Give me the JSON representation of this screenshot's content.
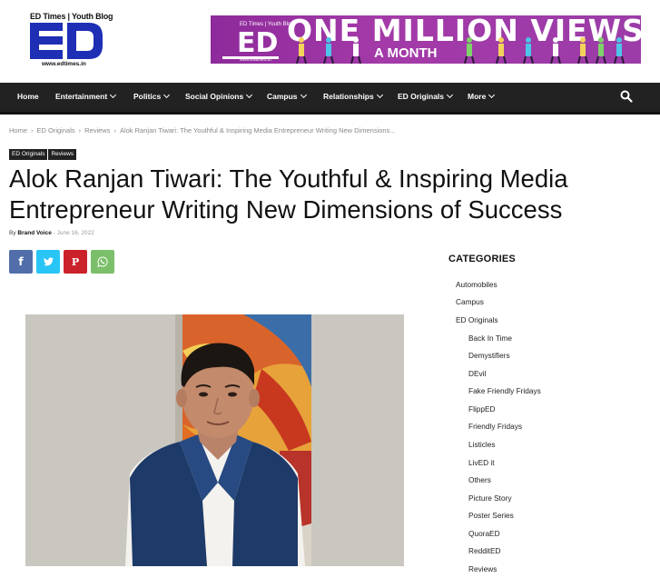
{
  "header": {
    "logo_tagline": "ED Times | Youth Blog",
    "logo_letters": "ED",
    "logo_url": "www.edtimes.in",
    "banner": {
      "tagline": "ED Times | Youth Blog",
      "letters": "ED",
      "url": "www.edtimes.in",
      "title": "ONE MILLION VIEWS",
      "subtitle": "A MONTH"
    }
  },
  "nav": {
    "items": [
      {
        "label": "Home",
        "dropdown": false
      },
      {
        "label": "Entertainment",
        "dropdown": true
      },
      {
        "label": "Politics",
        "dropdown": true
      },
      {
        "label": "Social Opinions",
        "dropdown": true
      },
      {
        "label": "Campus",
        "dropdown": true
      },
      {
        "label": "Relationships",
        "dropdown": true
      },
      {
        "label": "ED Originals",
        "dropdown": true
      },
      {
        "label": "More",
        "dropdown": true
      }
    ],
    "search_icon": "search-icon"
  },
  "breadcrumb": [
    "Home",
    "ED Originals",
    "Reviews",
    "Alok Ranjan Tiwari: The Youthful & Inspiring Media Entrepreneur Writing New Dimensions..."
  ],
  "tags": [
    "ED Originals",
    "Reviews"
  ],
  "article": {
    "title": "Alok Ranjan Tiwari: The Youthful & Inspiring Media Entrepreneur Writing New Dimensions of Success",
    "by": "By",
    "author": "Brand Voice",
    "separator": "-",
    "date": "June 16, 2022"
  },
  "share": {
    "facebook": "f",
    "twitter": "twitter-icon",
    "pinterest": "P",
    "whatsapp": "whatsapp-icon"
  },
  "sidebar": {
    "title": "CATEGORIES",
    "categories": [
      {
        "label": "Automobiles",
        "level": 0
      },
      {
        "label": "Campus",
        "level": 0
      },
      {
        "label": "ED Originals",
        "level": 0
      },
      {
        "label": "Back In Time",
        "level": 1
      },
      {
        "label": "Demystifiers",
        "level": 1
      },
      {
        "label": "DEvil",
        "level": 1
      },
      {
        "label": "Fake Friendly Fridays",
        "level": 1
      },
      {
        "label": "FlippED",
        "level": 1
      },
      {
        "label": "Friendly Fridays",
        "level": 1
      },
      {
        "label": "Listicles",
        "level": 1
      },
      {
        "label": "LivED it",
        "level": 1
      },
      {
        "label": "Others",
        "level": 1
      },
      {
        "label": "Picture Story",
        "level": 1
      },
      {
        "label": "Poster Series",
        "level": 1
      },
      {
        "label": "QuoraED",
        "level": 1
      },
      {
        "label": "RedditED",
        "level": 1
      },
      {
        "label": "Reviews",
        "level": 1
      }
    ]
  },
  "colors": {
    "nav_bg": "#222222",
    "logo_blue": "#1f2fb5",
    "banner_purple": "#9b3ca8",
    "facebook": "#516eab",
    "twitter": "#29c5f6",
    "pinterest": "#ca212a",
    "whatsapp": "#7bbf6a"
  }
}
